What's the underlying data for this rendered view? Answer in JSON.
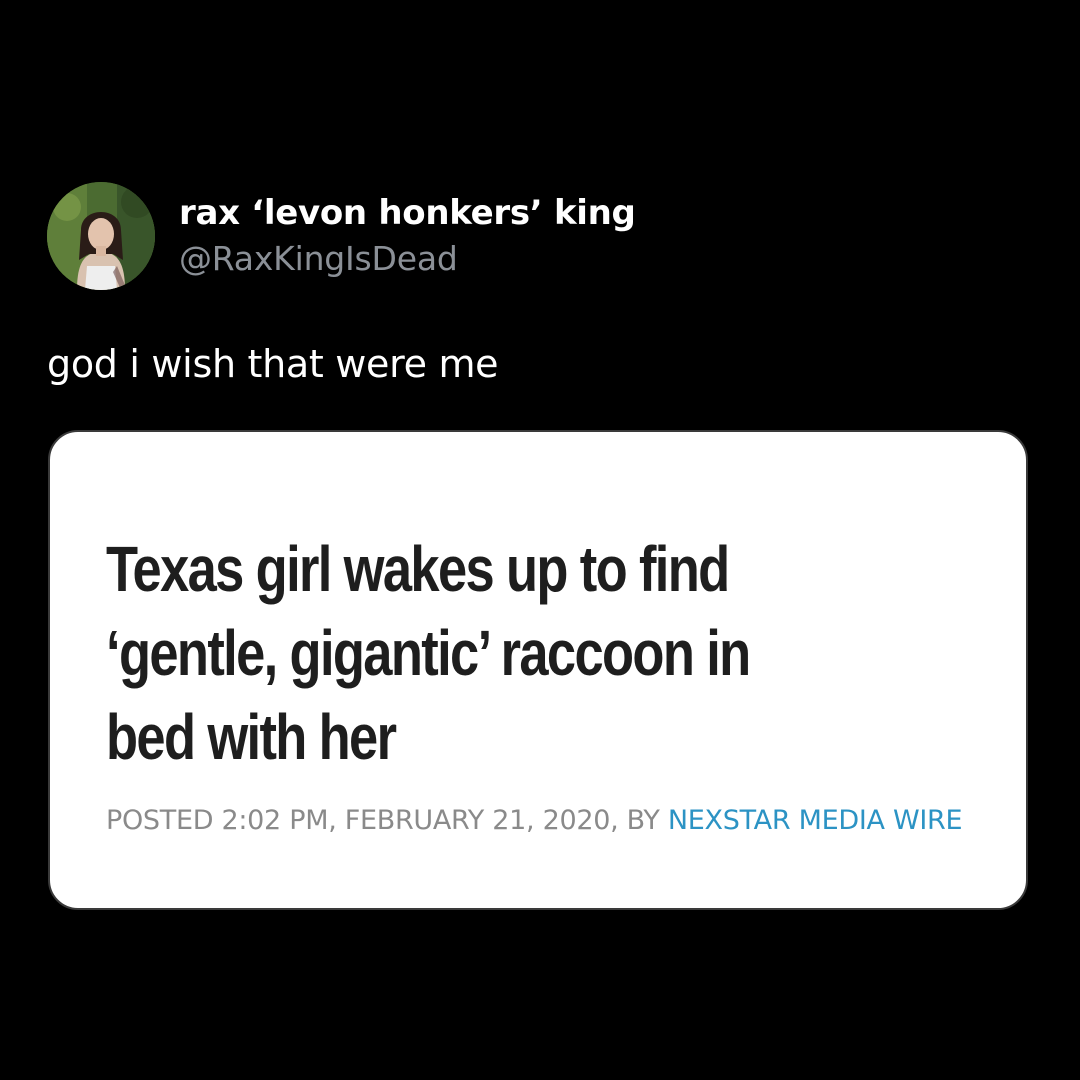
{
  "tweet": {
    "display_name": "rax ‘levon honkers’ king",
    "handle": "@RaxKingIsDead",
    "text": "god i wish that were me"
  },
  "article_card": {
    "headline": "Texas girl wakes up to find ‘gentle, gigantic’ raccoon in bed with her",
    "posted_prefix": "POSTED 2:02 PM, FEBRUARY 21, 2020, BY ",
    "author": "NEXSTAR MEDIA WIRE"
  },
  "colors": {
    "background": "#000000",
    "handle_gray": "#8b9097",
    "byline_gray": "#8a8a8a",
    "author_link_blue": "#2c93c4",
    "headline_text": "#1e1e1e"
  }
}
